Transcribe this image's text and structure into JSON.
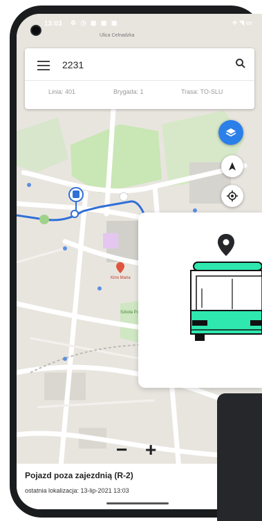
{
  "status_bar": {
    "time": "13:03",
    "icons": "⚙ ◷ ▣ ▣ ▣",
    "right": "✈ ◥ ▭"
  },
  "search": {
    "query": "2231"
  },
  "vehicle_info": {
    "line": "Linia: 401",
    "brigade": "Brygada: 1",
    "route": "Trasa: TO-SLU"
  },
  "map": {
    "zoom_in": "+",
    "zoom_out": "−",
    "top_label": "Ulica Celnadzka",
    "poi_label": "Kino Maria",
    "park_label": "Szkoła Podstawowa"
  },
  "vehicle_status": {
    "title": "Pojazd poza zajezdnią (R-2)",
    "last_location": "ostatnia lokalizacja: 13-lip-2021 13:03"
  },
  "colors": {
    "accent_blue": "#2b7fe8",
    "bus_green": "#2ee8b0",
    "route_blue": "#2f6fd6"
  }
}
